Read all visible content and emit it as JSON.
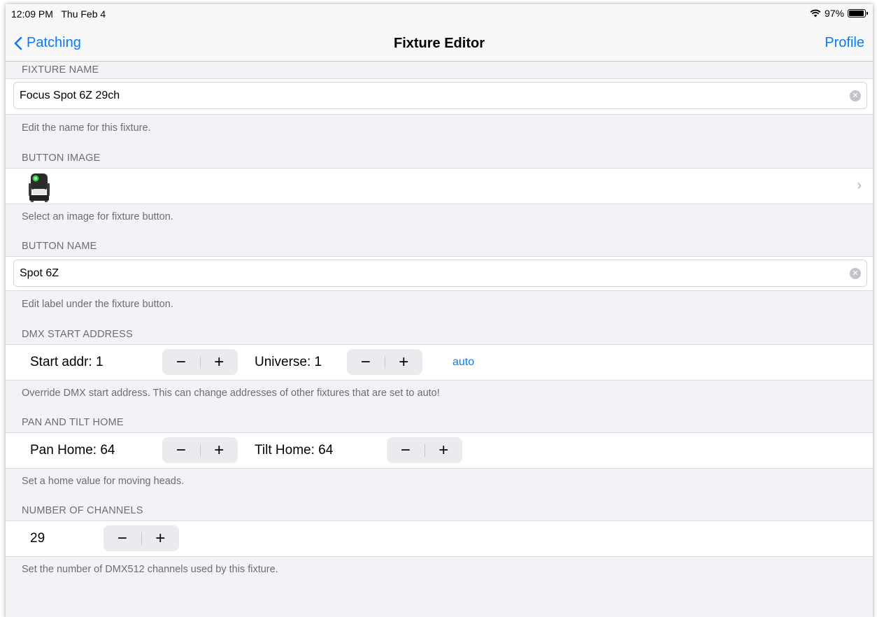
{
  "status": {
    "time": "12:09 PM",
    "date": "Thu Feb 4",
    "battery": "97%",
    "battery_level": 0.97
  },
  "nav": {
    "back_label": "Patching",
    "title": "Fixture Editor",
    "profile_label": "Profile"
  },
  "fixture_name": {
    "header": "FIXTURE NAME",
    "value": "Focus Spot 6Z 29ch",
    "footer": "Edit the name for this fixture."
  },
  "button_image": {
    "header": "BUTTON IMAGE",
    "icon": "moving-head-fixture-icon",
    "footer": "Select an image for fixture button."
  },
  "button_name": {
    "header": "BUTTON NAME",
    "value": "Spot 6Z",
    "footer": "Edit label under the fixture button."
  },
  "dmx": {
    "header": "DMX START ADDRESS",
    "start_label": "Start addr: 1",
    "universe_label": "Universe: 1",
    "auto_label": "auto",
    "footer": "Override DMX start address. This can change addresses of other fixtures that are set to auto!"
  },
  "pan_tilt": {
    "header": "PAN AND TILT HOME",
    "pan_label": "Pan Home: 64",
    "tilt_label": "Tilt Home: 64",
    "footer": "Set a home value for moving heads."
  },
  "channels": {
    "header": "NUMBER OF CHANNELS",
    "value": "29",
    "footer": "Set the number of DMX512 channels used by this fixture."
  },
  "stepper": {
    "minus": "−",
    "plus": "+"
  },
  "colors": {
    "accent": "#0a7aff",
    "background": "#f2f2f7",
    "secondary_text": "#6d6d72"
  }
}
